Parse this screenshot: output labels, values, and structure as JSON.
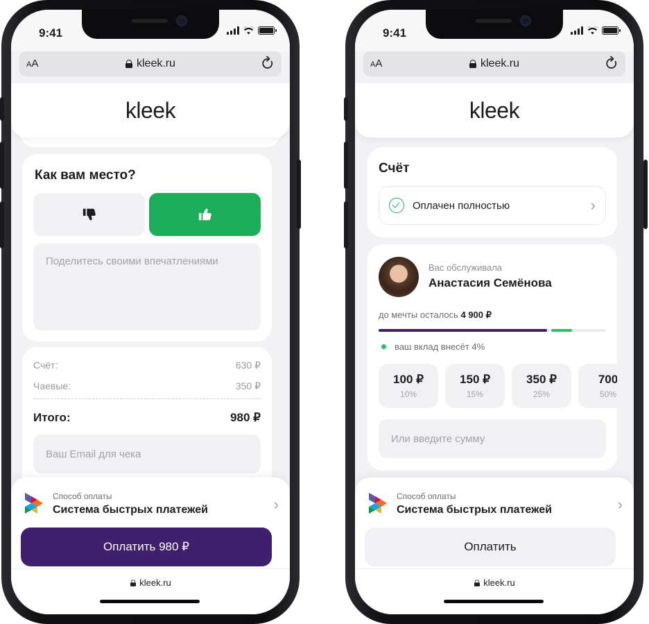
{
  "status_bar": {
    "time": "9:41"
  },
  "browser": {
    "aa_small": "A",
    "aa_big": "A",
    "domain": "kleek.ru",
    "reload_icon": "reload-icon"
  },
  "brand": {
    "logo": "kleek"
  },
  "colors": {
    "green": "#1cae5b",
    "purple": "#3f1f6e",
    "light_green": "#22c55e"
  },
  "left": {
    "feedback": {
      "title": "Как вам место?",
      "dislike_icon": "thumbs-down-icon",
      "like_icon": "thumbs-up-icon",
      "placeholder": "Поделитесь своими впечатлениями"
    },
    "summary": {
      "bill_label": "Счёт:",
      "bill_value": "630 ₽",
      "tips_label": "Чаевые:",
      "tips_value": "350 ₽",
      "total_label": "Итого:",
      "total_value": "980 ₽",
      "email_placeholder": "Ваш Email для чека"
    },
    "payment": {
      "method_caption": "Способ оплаты",
      "method_value": "Система быстрых платежей",
      "pay_button": "Оплатить 980 ₽"
    },
    "footer_url": "kleek.ru"
  },
  "right": {
    "bill": {
      "title": "Счёт",
      "status": "Оплачен полностью"
    },
    "waiter": {
      "caption": "Вас обслуживала",
      "name": "Анастасия Семёнова",
      "goal_text": "до мечты осталось",
      "goal_amount": "4 900 ₽",
      "progress_paid_fraction": 0.74,
      "progress_contribution_fraction": 0.04,
      "contribution_text": "ваш вклад внесёт 4%"
    },
    "tip_options": [
      {
        "amount": "100 ₽",
        "percent": "10%"
      },
      {
        "amount": "150 ₽",
        "percent": "15%"
      },
      {
        "amount": "350 ₽",
        "percent": "25%"
      },
      {
        "amount": "700",
        "percent": "50%"
      }
    ],
    "custom_placeholder": "Или введите сумму",
    "payment": {
      "method_caption": "Способ оплаты",
      "method_value": "Система быстрых платежей",
      "pay_button": "Оплатить"
    },
    "footer_url": "kleek.ru"
  }
}
